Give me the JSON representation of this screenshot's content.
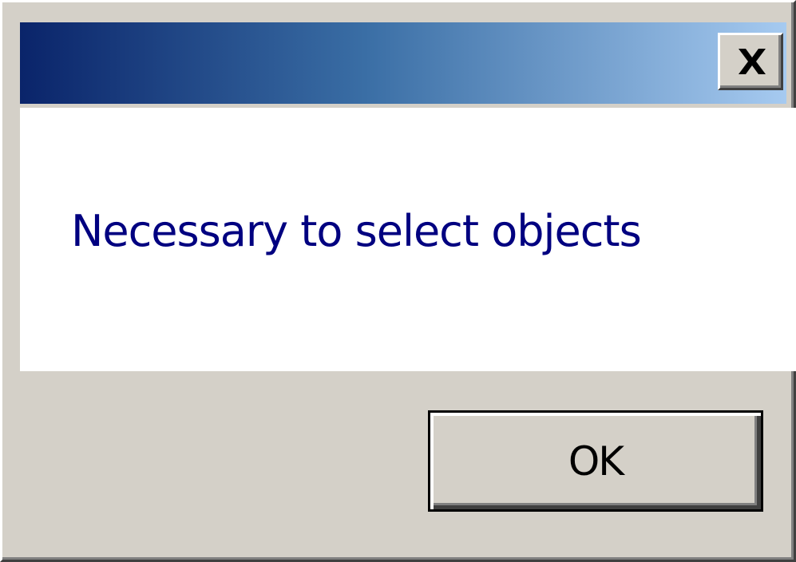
{
  "dialog": {
    "title": "",
    "message": "Necessary to select objects",
    "ok_label": "OK"
  },
  "title_bar": {
    "close_icon": "close-icon",
    "gradient_start": "#0a246a",
    "gradient_end": "#a6caf0"
  },
  "colors": {
    "message_text": "#000080",
    "dialog_face": "#d4d0c8",
    "message_background": "#ffffff"
  }
}
